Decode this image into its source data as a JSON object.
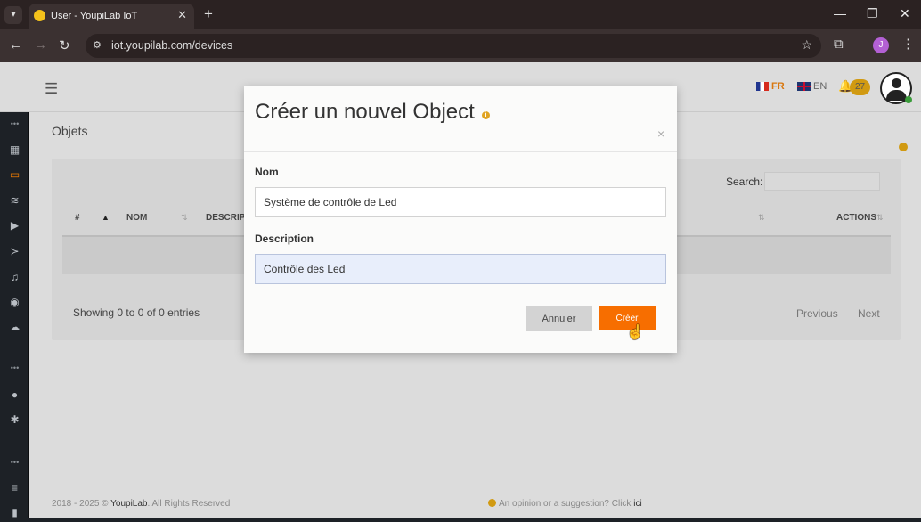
{
  "browser": {
    "tab_title": "User - YoupiLab IoT",
    "tab_close": "✕",
    "new_tab": "+",
    "url": "iot.youpilab.com/devices",
    "profile_initial": "J",
    "window": {
      "minimize": "—",
      "restore": "❐",
      "close": "✕"
    }
  },
  "header": {
    "langs": [
      {
        "code": "FR",
        "color": "#d9770e"
      },
      {
        "code": "EN",
        "color": "#666666"
      }
    ],
    "notification_count": "27"
  },
  "page": {
    "title": "Objets",
    "search_label": "Search:",
    "table": {
      "columns": [
        "#",
        "NOM",
        "DESCRIPTI",
        "ACTIONS"
      ],
      "rows": []
    },
    "info": "Showing 0 to 0 of 0 entries",
    "pagination": {
      "previous": "Previous",
      "next": "Next"
    }
  },
  "modal": {
    "title": "Créer un nouvel Object",
    "info_icon": "i",
    "close": "×",
    "fields": {
      "name_label": "Nom",
      "name_value": "Système de contrôle de Led",
      "description_label": "Description",
      "description_value": "Contrôle des Led"
    },
    "cancel_label": "Annuler",
    "create_label": "Créer"
  },
  "footer": {
    "copyright_prefix": "2018 - 2025 ©",
    "brand": "YoupiLab",
    "rights": ". All Rights Reserved",
    "feedback": "An opinion or a suggestion? Click",
    "feedback_link": "ici"
  },
  "colors": {
    "accent": "#f76e00",
    "sidebar_bg": "#1d2126",
    "badge": "#d19a12"
  },
  "icons": {
    "sidebar": [
      "dashboard-icon",
      "devices-icon",
      "database-icon",
      "play-icon",
      "terminal-icon",
      "bell-icon",
      "android-icon",
      "cloud-upload-icon",
      "user-icon",
      "gear-icon",
      "layers-icon",
      "book-icon"
    ]
  }
}
